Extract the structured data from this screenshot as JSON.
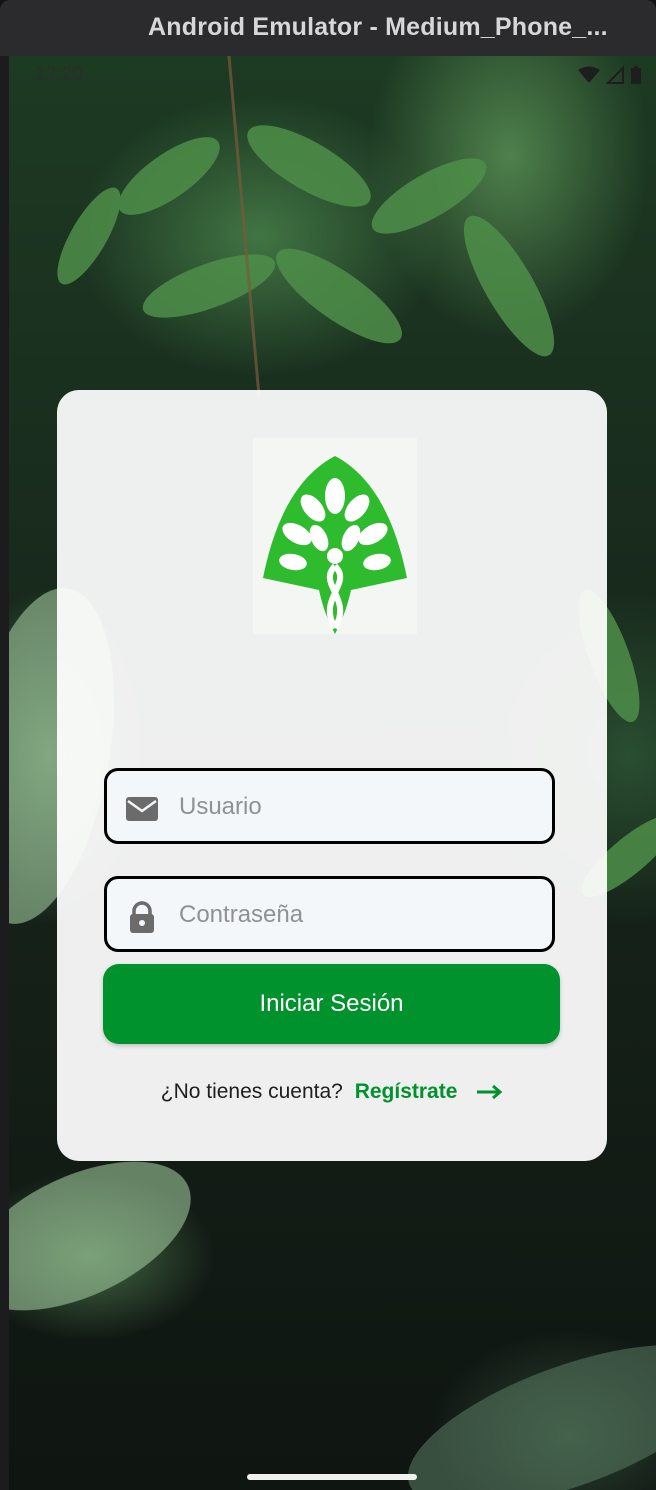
{
  "window": {
    "title": "Android Emulator - Medium_Phone_..."
  },
  "status_bar": {
    "time": "12:20"
  },
  "login": {
    "username_placeholder": "Usuario",
    "password_placeholder": "Contraseña",
    "submit_label": "Iniciar Sesión",
    "register_prompt": "¿No tienes cuenta?",
    "register_link": "Regístrate"
  },
  "colors": {
    "brand_green": "#00922d",
    "logo_green": "#2fbb2e"
  }
}
